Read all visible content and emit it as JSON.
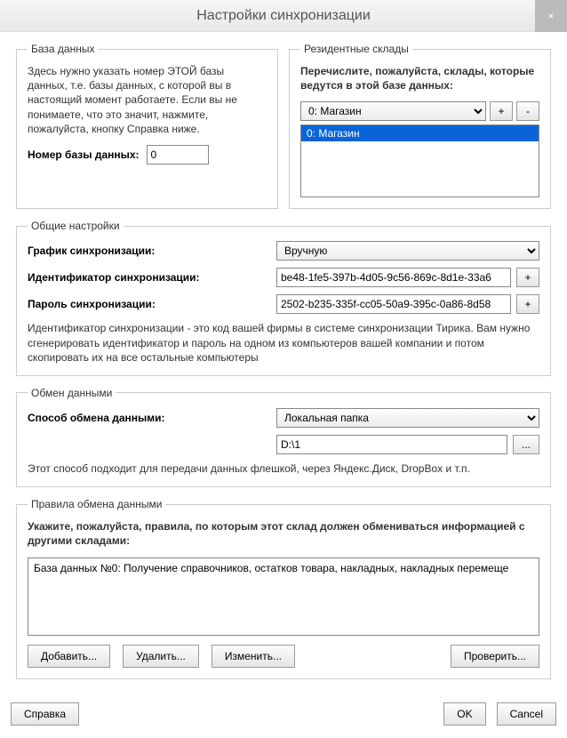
{
  "title": "Настройки синхронизации",
  "close_label": "×",
  "database": {
    "legend": "База данных",
    "desc": "Здесь нужно указать номер ЭТОЙ базы данных, т.е. базы данных, с которой вы в настоящий момент работаете. Если вы не понимаете, что это значит, нажмите, пожалуйста, кнопку Справка ниже.",
    "number_label": "Номер базы данных:",
    "number_value": "0"
  },
  "resident": {
    "legend": "Резидентные склады",
    "desc": "Перечислите, пожалуйста, склады, которые ведутся в этой базе данных:",
    "selected": "0: Магазин",
    "plus": "+",
    "minus": "-",
    "items": [
      "0: Магазин"
    ]
  },
  "common": {
    "legend": "Общие настройки",
    "schedule_label": "График синхронизации:",
    "schedule_value": "Вручную",
    "id_label": "Идентификатор синхронизации:",
    "id_value": "be48-1fe5-397b-4d05-9c56-869c-8d1e-33a6",
    "pwd_label": "Пароль синхронизации:",
    "pwd_value": "2502-b235-335f-cc05-50a9-395c-0a86-8d58",
    "plus": "+",
    "hint": "Идентификатор синхронизации - это код вашей фирмы в системе синхронизации Тирика. Вам нужно сгенерировать идентификатор и пароль на одном из компьютеров вашей компании и потом скопировать их на все остальные компьютеры"
  },
  "exchange": {
    "legend": "Обмен данными",
    "method_label": "Способ обмена данными:",
    "method_value": "Локальная папка",
    "path_value": "D:\\1",
    "browse": "...",
    "hint": "Этот способ подходит для передачи данных флешкой, через Яндекс.Диск, DropBox и т.п."
  },
  "rules": {
    "legend": "Правила обмена данными",
    "desc": "Укажите, пожалуйста, правила, по которым этот склад должен обмениваться информацией с другими складами:",
    "items": [
      "База данных №0: Получение справочников, остатков товара, накладных, накладных перемеще"
    ],
    "add": "Добавить...",
    "delete": "Удалить...",
    "edit": "Изменить...",
    "check": "Проверить..."
  },
  "buttons": {
    "help": "Справка",
    "ok": "OK",
    "cancel": "Cancel"
  }
}
